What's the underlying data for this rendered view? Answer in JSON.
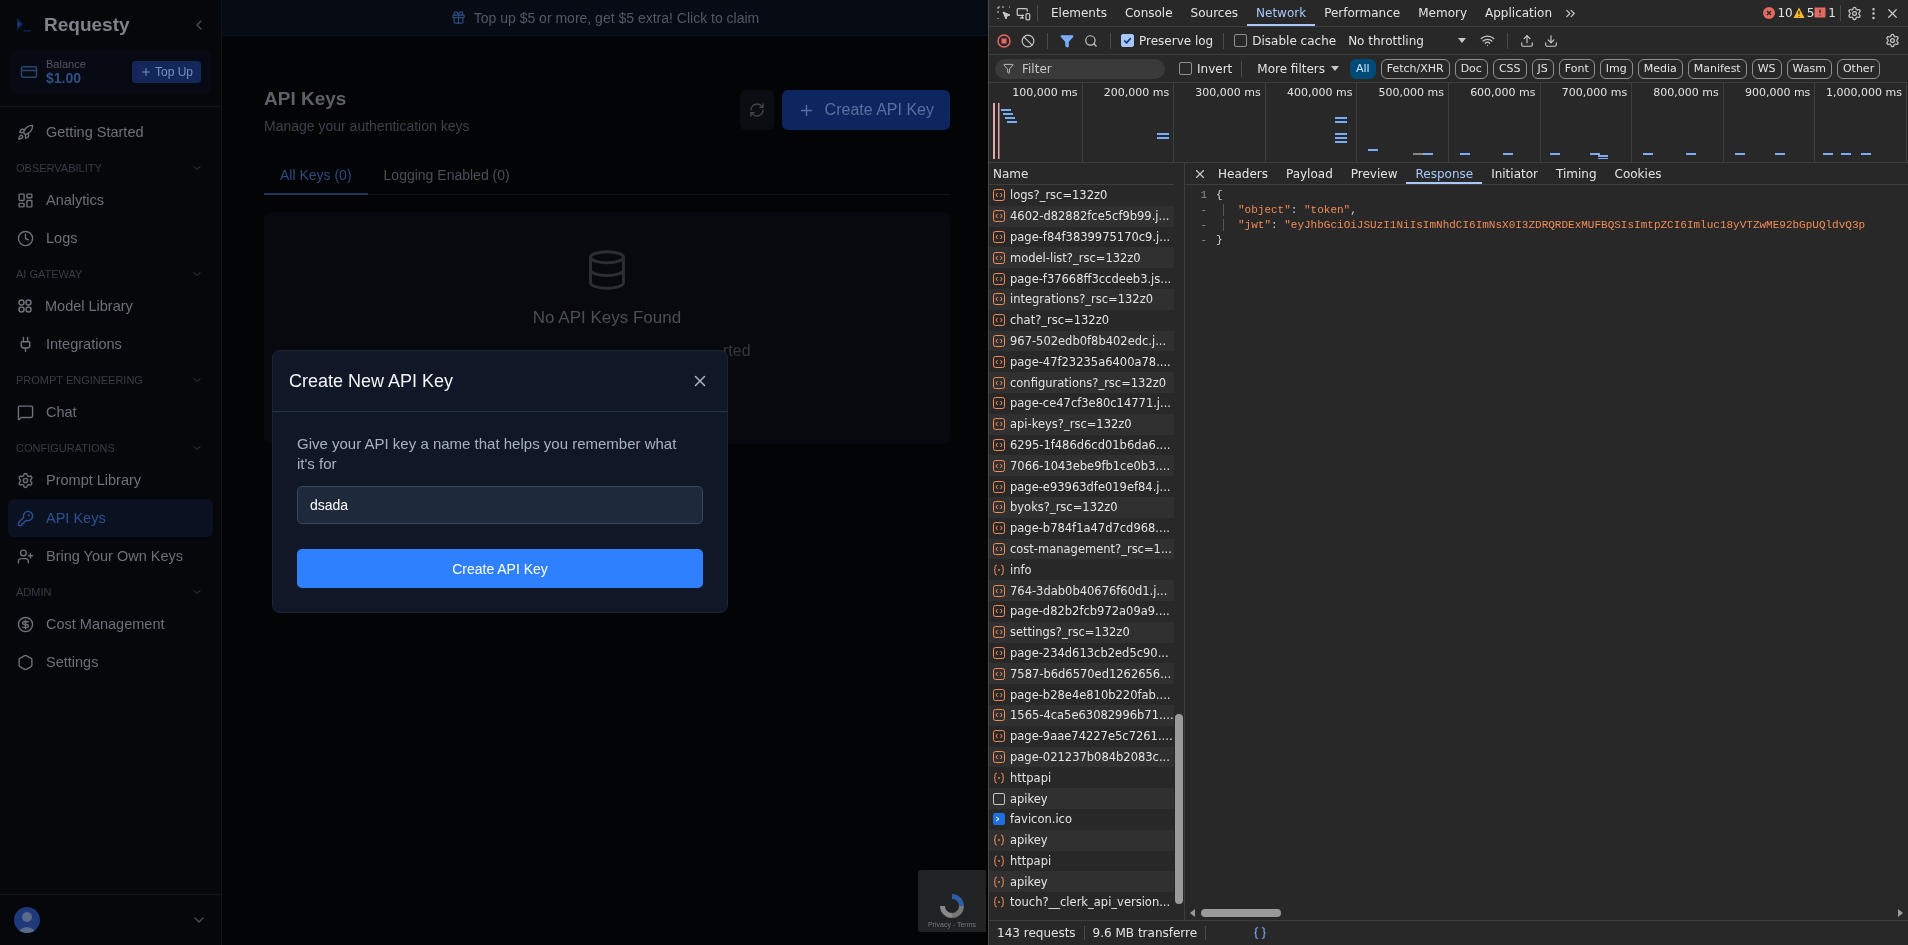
{
  "app": {
    "banner": {
      "text": "Top up $5 or more, get $5 extra! Click to claim"
    },
    "sidebar": {
      "brand": "Requesty",
      "balance": {
        "label": "Balance",
        "amount": "$1.00",
        "button": "Top Up"
      },
      "nav": [
        {
          "kind": "item",
          "label": "Getting Started",
          "selected": false
        },
        {
          "kind": "section",
          "title": "OBSERVABILITY",
          "expanded": true,
          "items": [
            {
              "label": "Analytics",
              "selected": false
            },
            {
              "label": "Logs",
              "selected": false
            }
          ]
        },
        {
          "kind": "section",
          "title": "AI GATEWAY",
          "expanded": true,
          "items": [
            {
              "label": "Model Library",
              "selected": false
            },
            {
              "label": "Integrations",
              "selected": false
            }
          ]
        },
        {
          "kind": "section",
          "title": "PROMPT ENGINEERING",
          "expanded": true,
          "items": [
            {
              "label": "Chat",
              "selected": false
            }
          ]
        },
        {
          "kind": "section",
          "title": "CONFIGURATIONS",
          "expanded": true,
          "items": [
            {
              "label": "Prompt Library",
              "selected": false
            },
            {
              "label": "API Keys",
              "selected": true
            },
            {
              "label": "Bring Your Own Keys",
              "selected": false
            }
          ]
        },
        {
          "kind": "section",
          "title": "ADMIN",
          "expanded": true,
          "items": [
            {
              "label": "Cost Management",
              "selected": false
            },
            {
              "label": "Settings",
              "selected": false
            }
          ]
        }
      ]
    },
    "page": {
      "title": "API Keys",
      "subtitle": "Manage your authentication keys",
      "create_button": "Create API Key",
      "tabs": [
        {
          "label": "All Keys (0)",
          "selected": true
        },
        {
          "label": "Logging Enabled (0)",
          "selected": false
        }
      ],
      "empty": {
        "title": "No API Keys Found",
        "subtitle_fragment": "rted"
      }
    },
    "dialog": {
      "title": "Create New API Key",
      "description": "Give your API key a name that helps you remember what it's for",
      "value": "dsada",
      "button": "Create API Key"
    },
    "recaptcha": {
      "text": "Privacy - Terms"
    }
  },
  "devtools": {
    "tabs": [
      {
        "label": "Elements",
        "selected": false
      },
      {
        "label": "Console",
        "selected": false
      },
      {
        "label": "Sources",
        "selected": false
      },
      {
        "label": "Network",
        "selected": true
      },
      {
        "label": "Performance",
        "selected": false
      },
      {
        "label": "Memory",
        "selected": false
      },
      {
        "label": "Application",
        "selected": false
      }
    ],
    "issues": [
      {
        "kind": "error",
        "count": "10"
      },
      {
        "kind": "warning",
        "count": "5"
      },
      {
        "kind": "info",
        "count": "1"
      }
    ],
    "toolbar": {
      "preserve_log": {
        "label": "Preserve log",
        "checked": true
      },
      "disable_cache": {
        "label": "Disable cache",
        "checked": false
      },
      "throttling": "No throttling"
    },
    "filter": {
      "placeholder": "Filter",
      "invert": {
        "label": "Invert",
        "checked": false
      },
      "more_filters": "More filters",
      "types": [
        {
          "label": "All",
          "selected": true
        },
        {
          "label": "Fetch/XHR",
          "selected": false
        },
        {
          "label": "Doc",
          "selected": false
        },
        {
          "label": "CSS",
          "selected": false
        },
        {
          "label": "JS",
          "selected": false
        },
        {
          "label": "Font",
          "selected": false
        },
        {
          "label": "Img",
          "selected": false
        },
        {
          "label": "Media",
          "selected": false
        },
        {
          "label": "Manifest",
          "selected": false
        },
        {
          "label": "WS",
          "selected": false
        },
        {
          "label": "Wasm",
          "selected": false
        },
        {
          "label": "Other",
          "selected": false
        }
      ]
    },
    "timeline": {
      "ticks": [
        "100,000 ms",
        "200,000 ms",
        "300,000 ms",
        "400,000 ms",
        "500,000 ms",
        "600,000 ms",
        "700,000 ms",
        "800,000 ms",
        "900,000 ms",
        "1,000,000 ms"
      ]
    },
    "requests": {
      "header": "Name",
      "rows": [
        {
          "name": "logs?_rsc=132z0",
          "kind": "doc"
        },
        {
          "name": "4602-d82882fce5cf9b99.j...",
          "kind": "doc"
        },
        {
          "name": "page-f84f3839975170c9.j...",
          "kind": "doc"
        },
        {
          "name": "model-list?_rsc=132z0",
          "kind": "doc"
        },
        {
          "name": "page-f37668ff3ccdeeb3.js...",
          "kind": "doc"
        },
        {
          "name": "integrations?_rsc=132z0",
          "kind": "doc"
        },
        {
          "name": "chat?_rsc=132z0",
          "kind": "doc"
        },
        {
          "name": "967-502edb0f8b402edc.j...",
          "kind": "doc"
        },
        {
          "name": "page-47f23235a6400a78....",
          "kind": "doc"
        },
        {
          "name": "configurations?_rsc=132z0",
          "kind": "doc"
        },
        {
          "name": "page-ce47cf3e80c14771.j...",
          "kind": "doc"
        },
        {
          "name": "api-keys?_rsc=132z0",
          "kind": "doc"
        },
        {
          "name": "6295-1f486d6cd01b6da6....",
          "kind": "doc"
        },
        {
          "name": "7066-1043ebe9fb1ce0b3....",
          "kind": "doc"
        },
        {
          "name": "page-e93963dfe019ef84.j...",
          "kind": "doc"
        },
        {
          "name": "byoks?_rsc=132z0",
          "kind": "doc"
        },
        {
          "name": "page-b784f1a47d7cd968....",
          "kind": "doc"
        },
        {
          "name": "cost-management?_rsc=1...",
          "kind": "doc"
        },
        {
          "name": "info",
          "kind": "fetch"
        },
        {
          "name": "764-3dab0b40676f60d1.j...",
          "kind": "doc"
        },
        {
          "name": "page-d82b2fcb972a09a9....",
          "kind": "doc"
        },
        {
          "name": "settings?_rsc=132z0",
          "kind": "doc"
        },
        {
          "name": "page-234d613cb2ed5c90...",
          "kind": "doc"
        },
        {
          "name": "7587-b6d6570ed1262656...",
          "kind": "doc"
        },
        {
          "name": "page-b28e4e810b220fab....",
          "kind": "doc"
        },
        {
          "name": "1565-4ca5e63082996b71....",
          "kind": "doc"
        },
        {
          "name": "page-9aae74227e5c7261....",
          "kind": "doc"
        },
        {
          "name": "page-021237b084b2083c...",
          "kind": "doc"
        },
        {
          "name": "httpapi",
          "kind": "fetch"
        },
        {
          "name": "apikey",
          "kind": "blank"
        },
        {
          "name": "favicon.ico",
          "kind": "image"
        },
        {
          "name": "apikey",
          "kind": "fetch"
        },
        {
          "name": "httpapi",
          "kind": "fetch"
        },
        {
          "name": "apikey",
          "kind": "fetch"
        },
        {
          "name": "touch?__clerk_api_version...",
          "kind": "fetch"
        }
      ]
    },
    "detail": {
      "tabs": [
        {
          "label": "Headers",
          "selected": false
        },
        {
          "label": "Payload",
          "selected": false
        },
        {
          "label": "Preview",
          "selected": false
        },
        {
          "label": "Response",
          "selected": true
        },
        {
          "label": "Initiator",
          "selected": false
        },
        {
          "label": "Timing",
          "selected": false
        },
        {
          "label": "Cookies",
          "selected": false
        }
      ],
      "lines": [
        {
          "gutter": "1",
          "kind": "punct",
          "text": "{"
        },
        {
          "gutter": "-",
          "kind": "pair",
          "key": "\"object\"",
          "sep": ": ",
          "value": "\"token\"",
          "trail": ","
        },
        {
          "gutter": "-",
          "kind": "pair",
          "key": "\"jwt\"",
          "sep": ": ",
          "value": "\"eyJhbGciOiJSUzI1NiIsImNhdCI6ImNsX0I3ZDRQRDExMUFBQSIsImtpZCI6Imluc18yVTZwME92bGpUQldvQ3p"
        },
        {
          "gutter": "-",
          "kind": "punct",
          "text": "}"
        }
      ]
    },
    "status": {
      "requests": "143 requests",
      "transferred": "9.6 MB transferre"
    }
  }
}
